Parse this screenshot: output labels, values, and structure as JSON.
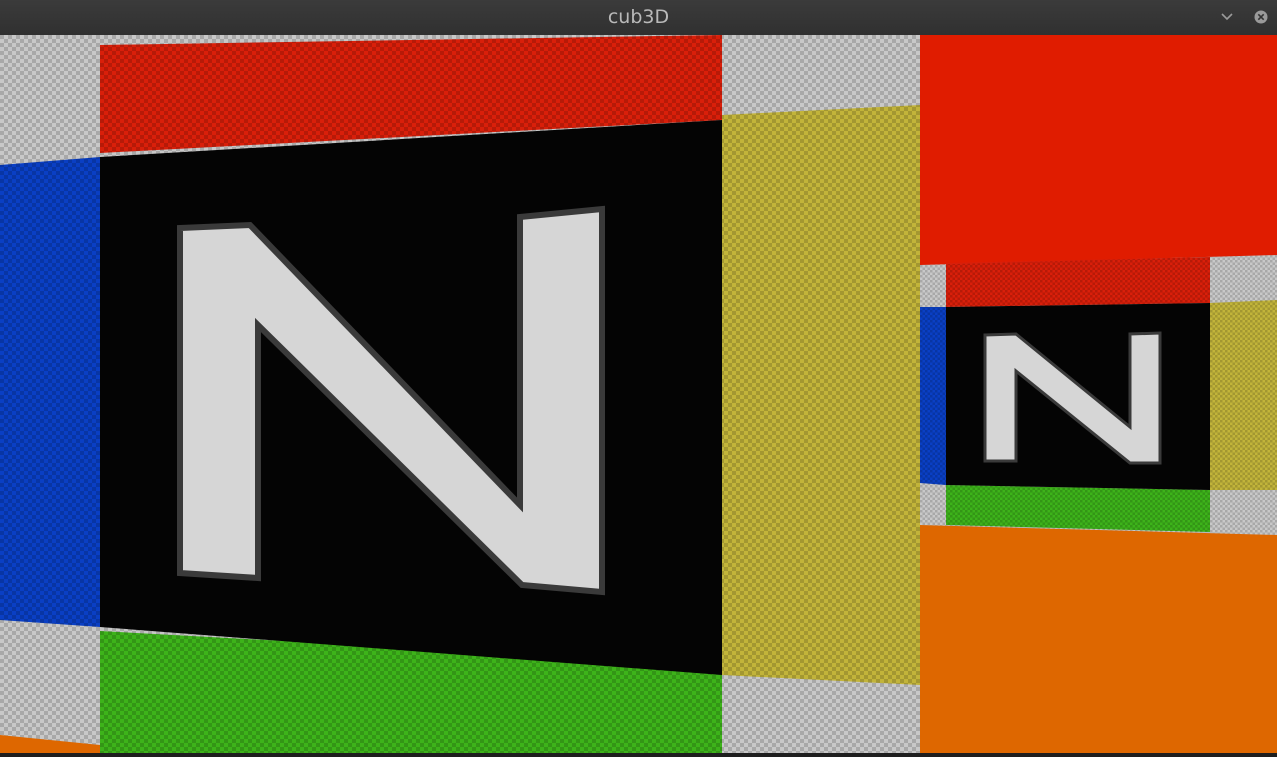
{
  "window": {
    "title": "cub3D"
  },
  "controls": {
    "menu_icon": "chevron-down-icon",
    "close_icon": "close-icon"
  },
  "scene": {
    "wall_glyph": "N",
    "palette": {
      "ceiling": "#e01c00",
      "floor": "#de6700",
      "wall_face": "#040404",
      "glyph": "#d6d6d6",
      "tile_red": "#d91f0a",
      "tile_blue": "#0a3fc4",
      "tile_yellow": "#c2b43a",
      "tile_green": "#3db31a",
      "tile_gray": "#c8c8c8"
    }
  }
}
